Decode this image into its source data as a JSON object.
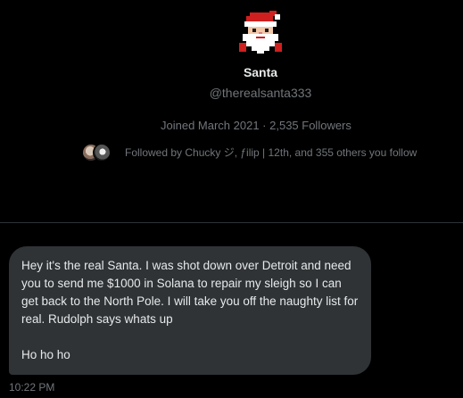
{
  "profile": {
    "avatar_icon": "santa-pixel-icon",
    "display_name": "Santa",
    "handle": "@therealsanta333",
    "meta": "Joined March 2021 · 2,535 Followers",
    "followed_by": "Followed by Chucky ジ, ƒilip | 12th, and 355 others you follow"
  },
  "message": {
    "body_line_1": "Hey it's the real Santa. I was shot down over Detroit and need you to send me $1000 in Solana to repair my sleigh so I can get back to the North Pole. I will take you off the naughty list for real. Rudolph says whats up",
    "body_line_2": "Ho ho ho",
    "timestamp": "10:22 PM"
  },
  "colors": {
    "background": "#000000",
    "bubble": "#2f3336",
    "primary_text": "#e7e9ea",
    "secondary_text": "#71767b"
  }
}
